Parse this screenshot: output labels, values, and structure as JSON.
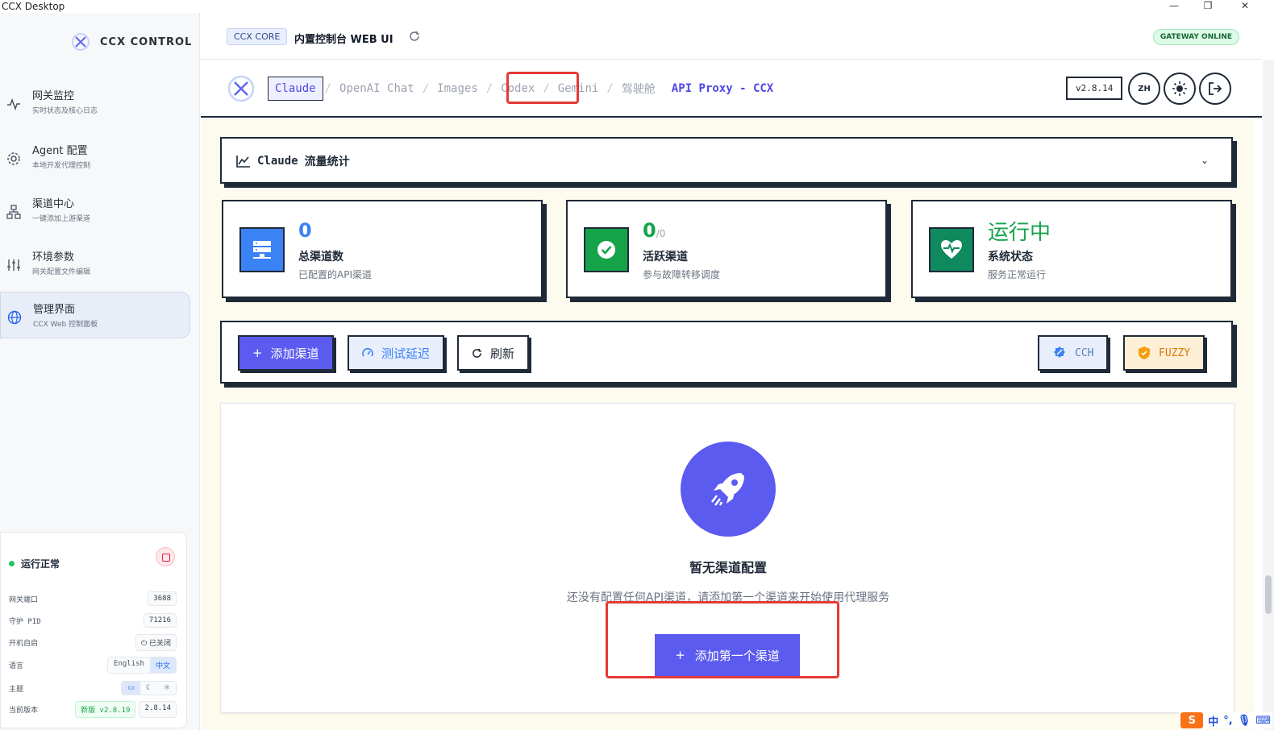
{
  "window": {
    "title": "CCX Desktop",
    "min": "—",
    "max": "❐",
    "close": "✕"
  },
  "sidebar": {
    "brand": "CCX CONTROL",
    "items": [
      {
        "label": "网关监控",
        "sub": "实时状态及核心日志",
        "icon": "activity-icon"
      },
      {
        "label": "Agent 配置",
        "sub": "本地开发代理控制",
        "icon": "gear-icon"
      },
      {
        "label": "渠道中心",
        "sub": "一键添加上游渠道",
        "icon": "network-icon"
      },
      {
        "label": "环境参数",
        "sub": "网关配置文件编辑",
        "icon": "sliders-icon"
      },
      {
        "label": "管理界面",
        "sub": "CCX Web 控制面板",
        "icon": "globe-icon"
      }
    ],
    "status": {
      "title": "运行正常",
      "port_label": "网关端口",
      "port_value": "3688",
      "pid_label": "守护 PID",
      "pid_value": "71216",
      "autostart_label": "开机自启",
      "autostart_value": "已关闭",
      "lang_label": "语言",
      "lang_en": "English",
      "lang_zh": "中文",
      "theme_label": "主题",
      "version_label": "当前版本",
      "new_version": "新版 v2.8.19",
      "current_version": "2.8.14"
    }
  },
  "topbar": {
    "badge": "CCX CORE",
    "title": "内置控制台 WEB UI",
    "gateway": "GATEWAY ONLINE"
  },
  "header": {
    "tabs": [
      "Claude",
      "OpenAI Chat",
      "Images",
      "Codex",
      "Gemini",
      "驾驶舱"
    ],
    "sep": "/",
    "brand": "API Proxy - CCX",
    "version": "v2.8.14",
    "lang": "ZH"
  },
  "traffic": {
    "title_prefix": "Claude",
    "title": "流量统计"
  },
  "stats": [
    {
      "value": "0",
      "label": "总渠道数",
      "sub": "已配置的API渠道",
      "color": "#3b82f6"
    },
    {
      "value": "0",
      "value_suffix": "/0",
      "label": "活跃渠道",
      "sub": "参与故障转移调度",
      "color": "#16a34a"
    },
    {
      "value": "运行中",
      "label": "系统状态",
      "sub": "服务正常运行",
      "color": "#16a34a"
    }
  ],
  "toolbar": {
    "add": "添加渠道",
    "ping": "测试延迟",
    "refresh": "刷新",
    "cch": "CCH",
    "fuzzy": "FUZZY"
  },
  "empty": {
    "title": "暂无渠道配置",
    "desc": "还没有配置任何API渠道，请添加第一个渠道来开始使用代理服务",
    "button": "添加第一个渠道"
  },
  "ime": {
    "label": "中"
  },
  "colors": {
    "accent": "#5b5bf0",
    "border": "#1f2937",
    "content_bg": "#fdfaee",
    "annotation": "#e53935"
  }
}
